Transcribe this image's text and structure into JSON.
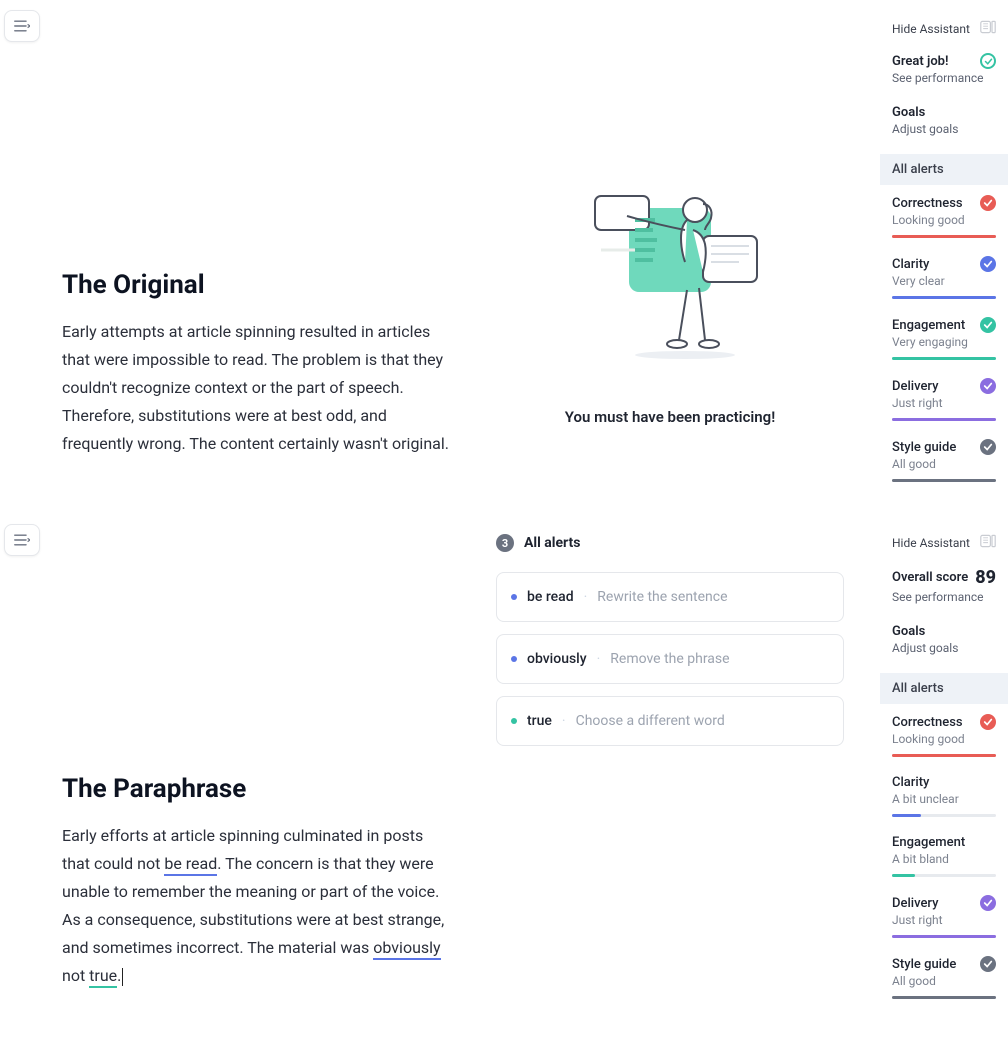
{
  "toggle": {
    "icon": "menu-icon"
  },
  "doc": {
    "original": {
      "title": "The Original",
      "body": "Early attempts at article spinning resulted in articles that were impossible to read. The problem is that they couldn't recognize context or the part of speech. Therefore, substitutions were at best odd, and frequently wrong. The content certainly wasn't original."
    },
    "paraphrase": {
      "title": "The Paraphrase",
      "seg1": "Early efforts at article spinning culminated in posts that could not ",
      "mark_be_read": "be read",
      "seg2": ". The concern is that they were unable to remember the meaning or part of the voice. As a consequence, substitutions were at best strange, and sometimes incorrect. The material was ",
      "mark_obviously": "obviously",
      "seg3": " not ",
      "mark_true": "true",
      "seg4": "."
    }
  },
  "praise": {
    "text": "You must have been practicing!"
  },
  "alertsBlock": {
    "count": "3",
    "label": "All alerts",
    "items": [
      {
        "dot": "blue",
        "word": "be read",
        "suggest": "Rewrite the sentence"
      },
      {
        "dot": "blue",
        "word": "obviously",
        "suggest": "Remove the phrase"
      },
      {
        "dot": "teal",
        "word": "true",
        "suggest": "Choose a different word"
      }
    ]
  },
  "sidebars": [
    {
      "hide": "Hide Assistant",
      "perf": {
        "title": "Great job!",
        "sub": "See performance",
        "score": ""
      },
      "goals": {
        "title": "Goals",
        "sub": "Adjust goals"
      },
      "allalerts": "All alerts",
      "cats": [
        {
          "name": "Correctness",
          "sub": "Looking good",
          "fill": "fill-red",
          "cc": "cc-red"
        },
        {
          "name": "Clarity",
          "sub": "Very clear",
          "fill": "fill-blue",
          "cc": "cc-blue"
        },
        {
          "name": "Engagement",
          "sub": "Very engaging",
          "fill": "fill-teal",
          "cc": "cc-teal"
        },
        {
          "name": "Delivery",
          "sub": "Just right",
          "fill": "fill-purple",
          "cc": "cc-purple"
        },
        {
          "name": "Style guide",
          "sub": "All good",
          "fill": "fill-gray",
          "cc": "cc-gray"
        }
      ]
    },
    {
      "hide": "Hide Assistant",
      "perf": {
        "title": "Overall score",
        "sub": "See performance",
        "score": "89"
      },
      "goals": {
        "title": "Goals",
        "sub": "Adjust goals"
      },
      "allalerts": "All alerts",
      "cats": [
        {
          "name": "Correctness",
          "sub": "Looking good",
          "fill": "fill-red",
          "cc": "cc-red"
        },
        {
          "name": "Clarity",
          "sub": "A bit unclear",
          "fill": "fill-blue-30",
          "cc": ""
        },
        {
          "name": "Engagement",
          "sub": "A bit bland",
          "fill": "fill-teal-25",
          "cc": ""
        },
        {
          "name": "Delivery",
          "sub": "Just right",
          "fill": "fill-purple",
          "cc": "cc-purple"
        },
        {
          "name": "Style guide",
          "sub": "All good",
          "fill": "fill-gray",
          "cc": "cc-gray"
        }
      ]
    }
  ]
}
